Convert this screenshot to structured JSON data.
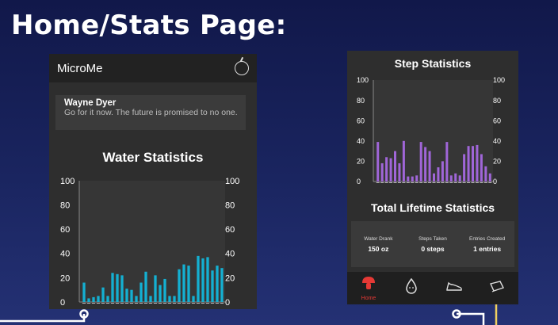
{
  "slide": {
    "title": "Home/Stats Page:"
  },
  "colors": {
    "water_bar": "#14b0d2",
    "step_bar": "#a066d8",
    "active_nav": "#e53935"
  },
  "phone1": {
    "app_name": "MicroMe",
    "header_icon": "apple-icon",
    "quote": {
      "author": "Wayne Dyer",
      "text": "Go for it now. The future is promised to no one."
    },
    "water_title": "Water Statistics"
  },
  "phone2": {
    "step_title": "Step Statistics",
    "lifetime_title": "Total Lifetime Statistics",
    "stats": [
      {
        "label": "Water Drank",
        "value": "150 oz"
      },
      {
        "label": "Steps Taken",
        "value": "0 steps"
      },
      {
        "label": "Entries Created",
        "value": "1 entries"
      }
    ],
    "nav": [
      {
        "icon": "mushroom-icon",
        "label": "Home"
      },
      {
        "icon": "water-drop-icon",
        "label": ""
      },
      {
        "icon": "shoe-icon",
        "label": ""
      },
      {
        "icon": "book-icon",
        "label": ""
      }
    ]
  },
  "chart_data": [
    {
      "type": "bar",
      "title": "Water Statistics",
      "ylim": [
        0,
        100
      ],
      "yticks": [
        0,
        20,
        40,
        60,
        80,
        100
      ],
      "values": [
        16,
        3,
        4,
        5,
        12,
        5,
        24,
        23,
        22,
        11,
        10,
        5,
        16,
        25,
        5,
        22,
        14,
        19,
        5,
        5,
        27,
        31,
        30,
        5,
        38,
        36,
        37,
        26,
        30,
        28
      ]
    },
    {
      "type": "bar",
      "title": "Step Statistics",
      "ylim": [
        0,
        100
      ],
      "yticks": [
        0,
        20,
        40,
        60,
        80,
        100
      ],
      "values": [
        39,
        18,
        24,
        23,
        30,
        18,
        40,
        5,
        5,
        6,
        39,
        34,
        30,
        8,
        14,
        20,
        39,
        6,
        8,
        6,
        27,
        35,
        35,
        36,
        27,
        15,
        8
      ]
    }
  ]
}
